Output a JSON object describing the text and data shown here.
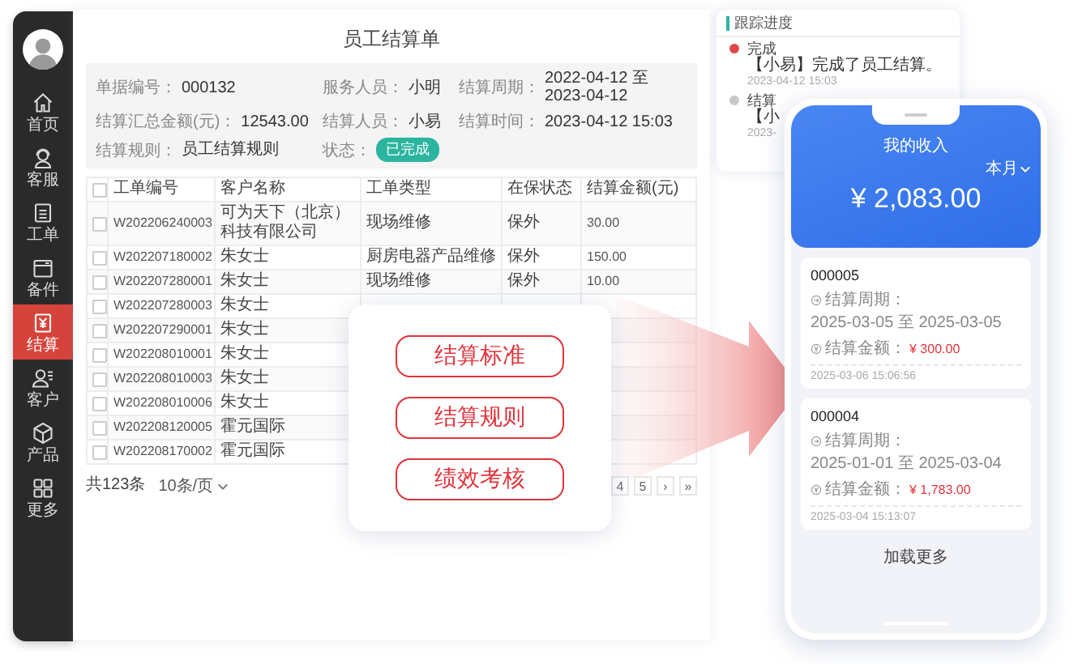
{
  "sidebar": {
    "items": [
      {
        "label": "首页",
        "selected": false
      },
      {
        "label": "客服",
        "selected": false
      },
      {
        "label": "工单",
        "selected": false
      },
      {
        "label": "备件",
        "selected": false
      },
      {
        "label": "结算",
        "selected": true
      },
      {
        "label": "客户",
        "selected": false
      },
      {
        "label": "产品",
        "selected": false
      },
      {
        "label": "更多",
        "selected": false
      }
    ]
  },
  "main": {
    "title": "员工结算单",
    "info": [
      {
        "label": "单据编号：",
        "value": "000132",
        "kind": "text"
      },
      {
        "label": "服务人员：",
        "value": "小明",
        "kind": "text"
      },
      {
        "label": "结算周期：",
        "value": "2022-04-12 至 2023-04-12",
        "kind": "text"
      },
      {
        "label": "结算汇总金额(元)：",
        "value": "12543.00",
        "kind": "text"
      },
      {
        "label": "结算人员：",
        "value": "小易",
        "kind": "text"
      },
      {
        "label": "结算时间：",
        "value": "2023-04-12 15:03",
        "kind": "text"
      },
      {
        "label": "结算规则：",
        "value": "员工结算规则",
        "kind": "text"
      },
      {
        "label": "状态：",
        "value": "已完成",
        "kind": "badge"
      }
    ],
    "table": {
      "header_checked": false,
      "columns": [
        "工单编号",
        "客户名称",
        "工单类型",
        "在保状态",
        "结算金额(元)"
      ],
      "rows": [
        {
          "checked": false,
          "cells": [
            "W202206240003",
            "可为天下（北京）科技有限公司",
            "现场维修",
            "保外",
            "30.00"
          ]
        },
        {
          "checked": false,
          "cells": [
            "W202207180002",
            "朱女士",
            "厨房电器产品维修",
            "保外",
            "150.00"
          ]
        },
        {
          "checked": false,
          "cells": [
            "W202207280001",
            "朱女士",
            "现场维修",
            "保外",
            "10.00"
          ]
        },
        {
          "checked": false,
          "cells": [
            "W202207280003",
            "朱女士"
          ]
        },
        {
          "checked": false,
          "cells": [
            "W202207290001",
            "朱女士"
          ]
        },
        {
          "checked": false,
          "cells": [
            "W202208010001",
            "朱女士"
          ]
        },
        {
          "checked": false,
          "cells": [
            "W202208010003",
            "朱女士"
          ]
        },
        {
          "checked": false,
          "cells": [
            "W202208010006",
            "朱女士"
          ]
        },
        {
          "checked": false,
          "cells": [
            "W202208120005",
            "霍元国际"
          ]
        },
        {
          "checked": false,
          "cells": [
            "W202208170002",
            "霍元国际"
          ]
        }
      ]
    },
    "footer": {
      "total": "共123条",
      "page_size": "10条/页",
      "pages": [
        "4",
        "5",
        "›",
        "»"
      ]
    }
  },
  "tracking": {
    "title": "跟踪进度",
    "events": [
      {
        "title": "完成",
        "text": "【小易】完成了员工结算。",
        "time": "2023-04-12 15:03",
        "color": "#e04848"
      },
      {
        "title": "结算",
        "text": "【小",
        "time": "2023-",
        "color": "#c8c8c8"
      }
    ]
  },
  "popup": {
    "buttons": [
      "结算标准",
      "结算规则",
      "绩效考核"
    ]
  },
  "phone": {
    "title": "我的收入",
    "period": "本月",
    "total": "¥ 2,083.00",
    "records": [
      {
        "id": "000005",
        "period_label": "结算周期：",
        "period": "2025-03-05 至 2025-03-05",
        "amount_label": "结算金额：",
        "amount": "¥ 300.00",
        "time": "2025-03-06 15:06:56"
      },
      {
        "id": "000004",
        "period_label": "结算周期：",
        "period": "2025-01-01 至 2025-03-04",
        "amount_label": "结算金额：",
        "amount": "¥ 1,783.00",
        "time": "2025-03-04 15:13:07"
      }
    ],
    "load_more": "加载更多"
  }
}
